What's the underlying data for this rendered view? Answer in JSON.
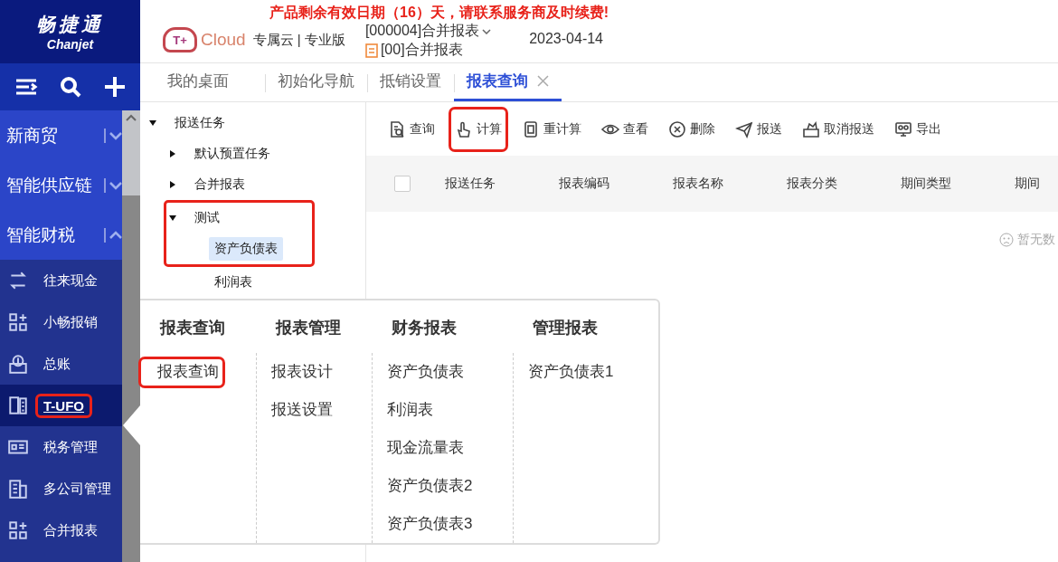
{
  "sidebar": {
    "logo": {
      "name": "畅捷通",
      "subtitle": "Chanjet"
    },
    "groups": [
      {
        "label": "新商贸",
        "expanded": false
      },
      {
        "label": "智能供应链",
        "expanded": false
      },
      {
        "label": "智能财税",
        "expanded": true
      }
    ],
    "items": [
      {
        "label": "往来现金",
        "selected": false,
        "highlighted": false
      },
      {
        "label": "小畅报销",
        "selected": false,
        "highlighted": false
      },
      {
        "label": "总账",
        "selected": false,
        "highlighted": false
      },
      {
        "label": "T-UFO",
        "selected": true,
        "highlighted": true
      },
      {
        "label": "税务管理",
        "selected": false,
        "highlighted": false
      },
      {
        "label": "多公司管理",
        "selected": false,
        "highlighted": false
      },
      {
        "label": "合并报表",
        "selected": false,
        "highlighted": false
      }
    ]
  },
  "header": {
    "notice": "产品剩余有效日期（16）天，请联系服务商及时续费!",
    "logo_mark": "T+",
    "cloud": "Cloud",
    "edition": "专属云 | 专业版",
    "company": "[000004]合并报表",
    "account_set": "[00]合并报表",
    "date": "2023-04-14"
  },
  "tabs": [
    {
      "label": "我的桌面",
      "selected": false,
      "closable": false
    },
    {
      "label": "初始化导航",
      "selected": false,
      "closable": false
    },
    {
      "label": "抵销设置",
      "selected": false,
      "closable": false
    },
    {
      "label": "报表查询",
      "selected": true,
      "closable": true
    }
  ],
  "tree": [
    {
      "label": "报送任务",
      "expanded": true,
      "selected": false,
      "highlighted": false,
      "children": [
        {
          "label": "默认预置任务",
          "expanded": false,
          "selected": false,
          "highlighted": false
        },
        {
          "label": "合并报表",
          "expanded": false,
          "selected": false,
          "highlighted": false
        },
        {
          "label": "测试",
          "expanded": true,
          "selected": false,
          "highlighted": true,
          "children": [
            {
              "label": "资产负债表",
              "selected": true,
              "highlighted": false
            },
            {
              "label": "利润表",
              "selected": false,
              "highlighted": false
            }
          ]
        }
      ]
    }
  ],
  "toolbar": [
    {
      "label": "查询",
      "highlighted": false
    },
    {
      "label": "计算",
      "highlighted": true
    },
    {
      "label": "重计算",
      "highlighted": false
    },
    {
      "label": "查看",
      "highlighted": false
    },
    {
      "label": "删除",
      "highlighted": false
    },
    {
      "label": "报送",
      "highlighted": false
    },
    {
      "label": "取消报送",
      "highlighted": false
    },
    {
      "label": "导出",
      "highlighted": false
    }
  ],
  "table": {
    "select_all": {
      "checked": false
    },
    "columns": [
      "报送任务",
      "报表编码",
      "报表名称",
      "报表分类",
      "期间类型",
      "期间"
    ],
    "empty_text": "暂无数"
  },
  "menu": {
    "columns": [
      {
        "heading": "报表查询",
        "items": [
          {
            "label": "报表查询",
            "highlighted": true
          }
        ]
      },
      {
        "heading": "报表管理",
        "items": [
          {
            "label": "报表设计",
            "highlighted": false
          },
          {
            "label": "报送设置",
            "highlighted": false
          }
        ]
      },
      {
        "heading": "财务报表",
        "items": [
          {
            "label": "资产负债表",
            "highlighted": false
          },
          {
            "label": "利润表",
            "highlighted": false
          },
          {
            "label": "现金流量表",
            "highlighted": false
          },
          {
            "label": "资产负债表2",
            "highlighted": false
          },
          {
            "label": "资产负债表3",
            "highlighted": false
          }
        ]
      },
      {
        "heading": "管理报表",
        "items": [
          {
            "label": "资产负债表1",
            "highlighted": false
          }
        ]
      }
    ]
  }
}
